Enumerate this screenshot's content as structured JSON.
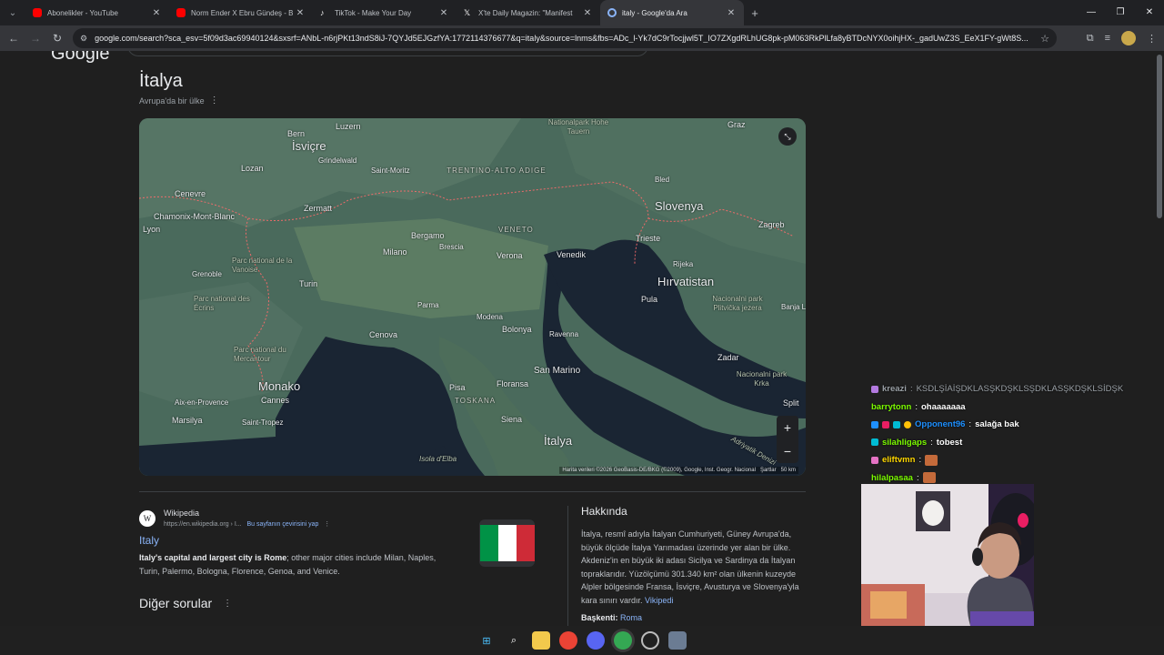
{
  "tabs": [
    {
      "title": "Abonelikler - YouTube",
      "icon": "youtube-icon"
    },
    {
      "title": "Norm Ender X Ebru Gündeş - B",
      "icon": "youtube-icon"
    },
    {
      "title": "TikTok - Make Your Day",
      "icon": "tiktok-icon"
    },
    {
      "title": "X'te Daily Magazin: \"Manifest",
      "icon": "x-icon"
    },
    {
      "title": "italy - Google'da Ara",
      "icon": "google-icon"
    }
  ],
  "url": "google.com/search?sca_esv=5f09d3ac69940124&sxsrf=ANbL-n6rjPKt13ndS8iJ-7QYJd5EJGzfYA:1772114376677&q=italy&source=lnms&fbs=ADc_l-Yk7dC9rTocjjwl5T_IO7ZXgdRLhUG8pk-pM063RkPlLfa8yBTDcNYX0oihjHX-_gadUwZ3S_EeX1FY-gWt8S...",
  "google_logo": "Google",
  "entity": {
    "title": "İtalya",
    "subtitle": "Avrupa'da bir ülke"
  },
  "map": {
    "labels": {
      "bern": "Bern",
      "luzern": "Luzern",
      "isvicre": "İsviçre",
      "grindelwald": "Grindelwald",
      "lozan": "Lozan",
      "cenevre": "Cenevre",
      "chamonix": "Chamonix-Mont-Blanc",
      "lyon": "Lyon",
      "grenoble": "Grenoble",
      "vanoise": "Parc national de la Vanoise",
      "ecrins": "Parc national des Écrins",
      "zermatt": "Zermatt",
      "saintmoritz": "Saint-Moritz",
      "trentino": "TRENTINO-ALTO ADIGE",
      "hohetauern": "Nationalpark Hohe Tauern",
      "graz": "Graz",
      "bled": "Bled",
      "slovenya": "Slovenya",
      "zagreb": "Zagreb",
      "bergamo": "Bergamo",
      "brescia": "Brescia",
      "veneto": "VENETO",
      "milano": "Milano",
      "verona": "Verona",
      "venedik": "Venedik",
      "trieste": "Trieste",
      "rijeka": "Rijeka",
      "hirvatistan": "Hırvatistan",
      "plitvice": "Nacionalni park Plitvička jezera",
      "banja": "Banja L",
      "turin": "Turin",
      "parma": "Parma",
      "modena": "Modena",
      "pula": "Pula",
      "bolonya": "Bolonya",
      "ravenna": "Ravenna",
      "cenova": "Cenova",
      "mercantour": "Parc national du Mercantour",
      "sanmarino": "San Marino",
      "zadar": "Zadar",
      "monako": "Monako",
      "krka": "Nacionalni park Krka",
      "aix": "Aix-en-Provence",
      "cannes": "Cannes",
      "pisa": "Pisa",
      "floransa": "Floransa",
      "toskana": "TOSKANA",
      "split": "Split",
      "marsilya": "Marsilya",
      "sainttropez": "Saint-Tropez",
      "siena": "Siena",
      "italya": "İtalya",
      "elba": "Isola d'Elba",
      "adriatik": "Adriyatik Denizi"
    },
    "attribution": "Harita verileri ©2026 GeoBasis-DE/BKG (©2009), Google, Inst. Geogr. Nacional",
    "terms": "Şartlar",
    "scale": "50 km"
  },
  "wiki": {
    "source": "Wikipedia",
    "url": "https://en.wikipedia.org › I...",
    "translate": "Bu sayfanın çevirisini yap",
    "link": "Italy",
    "snippet_bold": "Italy's capital and largest city is Rome",
    "snippet_rest": "; other major cities include Milan, Naples, Turin, Palermo, Bologna, Florence, Genoa, and Venice."
  },
  "other_questions": "Diğer sorular",
  "about": {
    "heading": "Hakkında",
    "text": "İtalya, resmî adıyla İtalyan Cumhuriyeti, Güney Avrupa'da, büyük ölçüde İtalya Yarımadası üzerinde yer alan bir ülke. Akdeniz'in en büyük iki adası Sicilya ve Sardinya da İtalyan topraklarıdır. Yüzölçümü 301.340 km² olan ülkenin kuzeyde Alpler bölgesinde Fransa, İsviçre, Avusturya ve Slovenya'yla kara sınırı vardır.",
    "source_link": "Vikipedi",
    "capital_label": "Başkenti:",
    "capital_value": "Roma"
  },
  "chat": [
    {
      "user": "kreazi",
      "msg": "KSDLŞİAİŞDKLASŞKDŞKLSŞDKLASŞKDŞKLSİDŞK",
      "color": "#9aa0a6",
      "emote": false
    },
    {
      "user": "barrytonn",
      "msg": "ohaaaaaaa",
      "color": "#7cfc00",
      "emote": false
    },
    {
      "user": "Opponent96",
      "msg": "salağa bak",
      "color": "#1e90ff",
      "emote": false
    },
    {
      "user": "silahligaps",
      "msg": "tobest",
      "color": "#7cfc00",
      "emote": false
    },
    {
      "user": "eliftvmn",
      "msg": "",
      "color": "#ffd700",
      "emote": true
    },
    {
      "user": "hilalpasaa",
      "msg": "",
      "color": "#7cfc00",
      "emote": true
    }
  ]
}
